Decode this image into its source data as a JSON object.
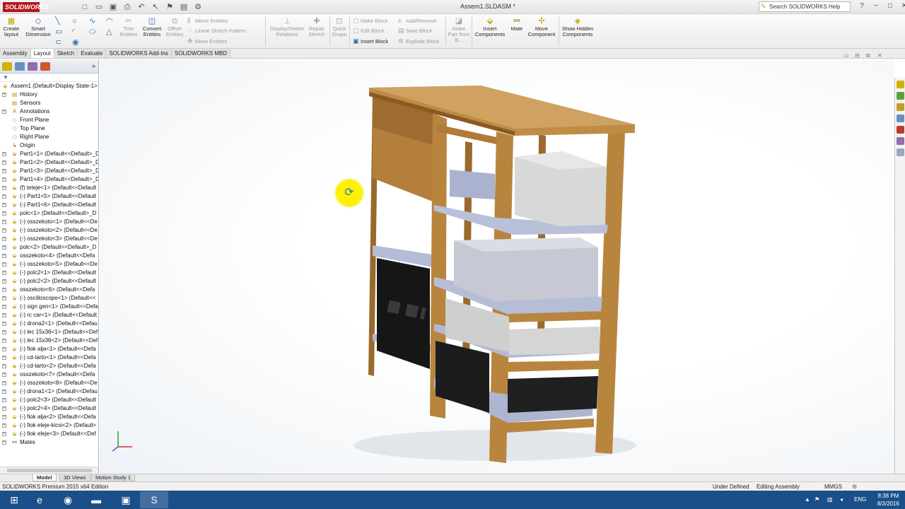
{
  "app": {
    "logo_text": "SOLIDWORKS",
    "doc_title": "Assem1.SLDASM *",
    "search_placeholder": "Search SOLIDWORKS Help",
    "window_controls": [
      "?",
      "−",
      "□",
      "✕"
    ]
  },
  "toolbar": {
    "create_layout": "Create layout",
    "smart_dimension": "Smart Dimension",
    "trim_entities": "Trim Entities",
    "convert_entities": "Convert Entities",
    "offset_entities": "Offset Entities",
    "mirror_entities": "Mirror Entities",
    "linear_sketch_pattern": "Linear Sketch Pattern",
    "move_entities": "Move Entities",
    "display_delete_relations": "Display/Delete Relations",
    "repair_sketch": "Repair Sketch",
    "quick_snaps": "Quick Snaps",
    "make_block": "Make Block",
    "edit_block": "Edit Block",
    "insert_block": "Insert Block",
    "add_remove": "Add/Remove",
    "save_block": "Save Block",
    "explode_block": "Explode Block",
    "make_part_from_block": "Make Part from B...",
    "insert_components": "Insert Components",
    "mate": "Mate",
    "move_component": "Move Component",
    "show_hidden_components": "Show Hidden Components"
  },
  "tabs": [
    "Assembly",
    "Layout",
    "Sketch",
    "Evaluate",
    "SOLIDWORKS Add-Ins",
    "SOLIDWORKS MBD"
  ],
  "active_tab": "Layout",
  "tree": {
    "root": "Assem1  (Default<Display State-1>",
    "items": [
      {
        "label": "History",
        "kind": "folder",
        "exp": true
      },
      {
        "label": "Sensors",
        "kind": "folder",
        "exp": false
      },
      {
        "label": "Annotations",
        "kind": "annot",
        "exp": true
      },
      {
        "label": "Front Plane",
        "kind": "plane",
        "exp": false
      },
      {
        "label": "Top Plane",
        "kind": "plane",
        "exp": false
      },
      {
        "label": "Right Plane",
        "kind": "plane",
        "exp": false
      },
      {
        "label": "Origin",
        "kind": "origin",
        "exp": false
      },
      {
        "label": "Part1<1> (Default<<Default>_D",
        "kind": "part",
        "exp": true
      },
      {
        "label": "Part1<2> (Default<<Default>_D",
        "kind": "part",
        "exp": true
      },
      {
        "label": "Part1<3> (Default<<Default>_D",
        "kind": "part",
        "exp": true
      },
      {
        "label": "Part1<4> (Default<<Default>_D",
        "kind": "part",
        "exp": true
      },
      {
        "label": "(f) teteje<1> (Default<<Default",
        "kind": "part",
        "exp": true
      },
      {
        "label": "(-) Part1<5> (Default<<Default",
        "kind": "part",
        "exp": true
      },
      {
        "label": "(-) Part1<6> (Default<<Default",
        "kind": "part",
        "exp": true
      },
      {
        "label": "polc<1> (Default<<Default>_D",
        "kind": "part",
        "exp": true
      },
      {
        "label": "(-) osszekoto<1> (Default<<De",
        "kind": "part",
        "exp": true
      },
      {
        "label": "(-) osszekoto<2> (Default<<De",
        "kind": "part",
        "exp": true
      },
      {
        "label": "(-) osszekoto<3> (Default<<De",
        "kind": "part",
        "exp": true
      },
      {
        "label": "polc<2> (Default<<Default>_D",
        "kind": "part",
        "exp": true
      },
      {
        "label": "osszekoto<4> (Default<<Defa",
        "kind": "part",
        "exp": true
      },
      {
        "label": "(-) osszekoto<5> (Default<<De",
        "kind": "part",
        "exp": true
      },
      {
        "label": "(-) polc2<1> (Default<<Default",
        "kind": "part",
        "exp": true
      },
      {
        "label": "(-) polc2<2> (Default<<Default",
        "kind": "part",
        "exp": true
      },
      {
        "label": "osszekoto<6> (Default<<Defa",
        "kind": "part",
        "exp": true
      },
      {
        "label": "(-) oscilloscope<1> (Default<<",
        "kind": "part",
        "exp": true
      },
      {
        "label": "(-) sign gen<1> (Default<<Defa",
        "kind": "part",
        "exp": true
      },
      {
        "label": "(-) rc car<1> (Default<<Default",
        "kind": "part",
        "exp": true
      },
      {
        "label": "(-) drona2<1> (Default<<Defau",
        "kind": "part",
        "exp": true
      },
      {
        "label": "(-) lec 15x36<1> (Default<<Def",
        "kind": "part",
        "exp": true
      },
      {
        "label": "(-) lec 15x36<2> (Default<<Def",
        "kind": "part",
        "exp": true
      },
      {
        "label": "(-) fiok alja<1> (Default<<Defa",
        "kind": "part",
        "exp": true
      },
      {
        "label": "(-) cd-tarto<1> (Default<<Defa",
        "kind": "part",
        "exp": true
      },
      {
        "label": "(-) cd-tarto<2> (Default<<Defa",
        "kind": "part",
        "exp": true
      },
      {
        "label": "osszekoto<7> (Default<<Defa",
        "kind": "part",
        "exp": true
      },
      {
        "label": "(-) osszekoto<8> (Default<<De",
        "kind": "part",
        "exp": true
      },
      {
        "label": "(-) drona1<1> (Default<<Defau",
        "kind": "part",
        "exp": true
      },
      {
        "label": "(-) polc2<3> (Default<<Default",
        "kind": "part",
        "exp": true
      },
      {
        "label": "(-) polc2<4> (Default<<Default",
        "kind": "part",
        "exp": true
      },
      {
        "label": "(-) fiok alja<2> (Default<<Defa",
        "kind": "part",
        "exp": true
      },
      {
        "label": "(-) fiok eleje-kicsi<2> (Default<",
        "kind": "part",
        "exp": true
      },
      {
        "label": "(-) fiok eleje<3> (Default<<Def",
        "kind": "part",
        "exp": true
      },
      {
        "label": "Mates",
        "kind": "mates",
        "exp": true
      }
    ]
  },
  "model_tabs": [
    "Model",
    "3D Views",
    "Motion Study 1"
  ],
  "status": {
    "edition": "SOLIDWORKS Premium 2015 x64 Edition",
    "state": "Under Defined",
    "mode": "Editing Assembly",
    "units": "MMGS"
  },
  "taskbar": {
    "lang": "ENG",
    "time": "8:38 PM",
    "date": "8/3/2016"
  },
  "colors": {
    "wood": "#b8853f",
    "wood_dark": "#8a5a22",
    "shelf": "#b8bfd8",
    "box": "#d6d6d6",
    "drawer": "#1e1e1e",
    "accent_red": "#b3141c",
    "taskbar": "#1b4f8a"
  }
}
